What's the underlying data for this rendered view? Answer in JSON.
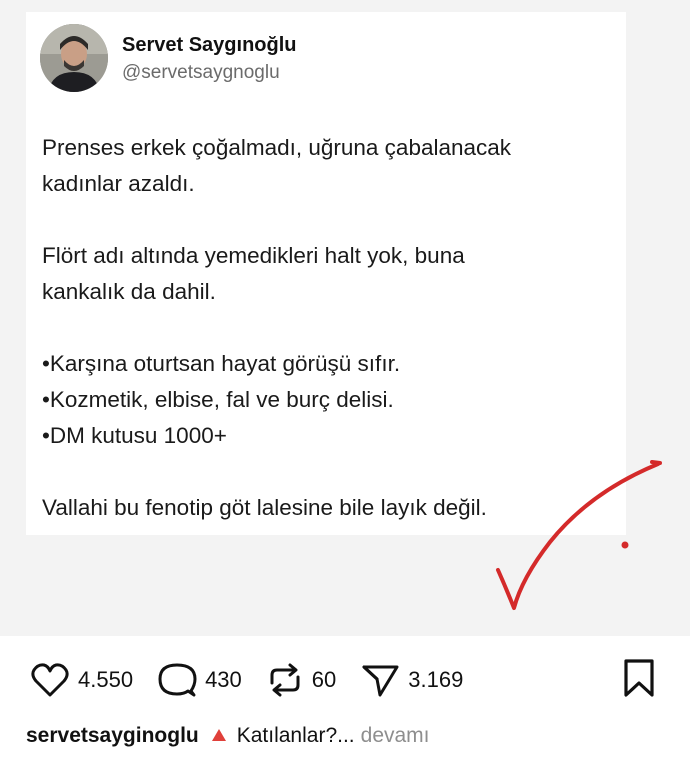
{
  "tweet": {
    "author_name": "Servet Saygınoğlu",
    "author_handle": "@servetsaygnoglu",
    "lines": [
      "Prenses erkek çoğalmadı, uğruna çabalanacak",
      "kadınlar azaldı.",
      "",
      "Flört adı altında yemedikleri halt yok, buna",
      "kankalık da dahil.",
      "",
      "•Karşına oturtsan hayat görüşü sıfır.",
      "•Kozmetik, elbise, fal ve burç delisi.",
      "•DM kutusu 1000+",
      "",
      "Vallahi bu fenotip göt lalesine bile layık değil."
    ]
  },
  "actions": {
    "likes": "4.550",
    "comments": "430",
    "reposts": "60",
    "shares": "3.169",
    "icons": [
      "heart-icon",
      "comment-icon",
      "repost-icon",
      "share-icon",
      "bookmark-icon"
    ]
  },
  "caption": {
    "username": "servetsayginoglu",
    "text": "Katılanlar?...",
    "more": "devamı",
    "emoji_color": "#e0403a"
  },
  "colors": {
    "checkmark": "#d42a2a",
    "background": "#f3f3f3"
  }
}
